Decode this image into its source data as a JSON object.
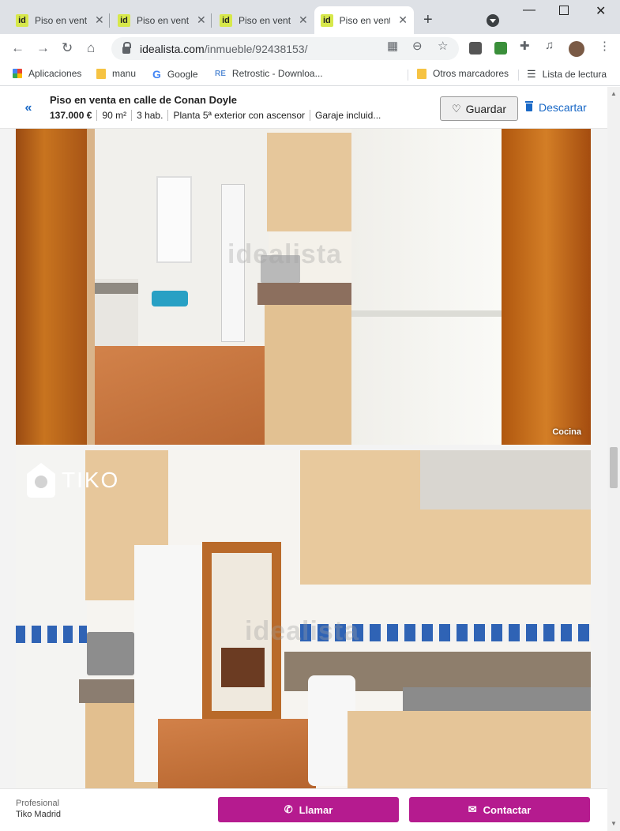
{
  "browser": {
    "tabs": [
      {
        "favicon": "id",
        "title": "Piso en venta"
      },
      {
        "favicon": "id",
        "title": "Piso en venta"
      },
      {
        "favicon": "id",
        "title": "Piso en venta"
      },
      {
        "favicon": "id",
        "title": "Piso en venta"
      }
    ],
    "active_tab_index": 3,
    "url_domain": "idealista.com",
    "url_path": "/inmueble/92438153/",
    "bookmarks": [
      {
        "label": "Aplicaciones",
        "icon": "apps-grid-icon"
      },
      {
        "label": "manu",
        "icon": "folder-icon"
      },
      {
        "label": "Google",
        "icon": "google-icon"
      },
      {
        "label": "Retrostic - Downloa...",
        "icon": "retrostic-icon"
      }
    ],
    "other_bookmarks": "Otros marcadores",
    "reading_list": "Lista de lectura"
  },
  "listing": {
    "title": "Piso en venta en calle de Conan Doyle",
    "price": "137.000 €",
    "area": "90 m²",
    "rooms": "3 hab.",
    "floor": "Planta 5ª exterior con ascensor",
    "garage": "Garaje incluid...",
    "save_label": "Guardar",
    "discard_label": "Descartar"
  },
  "photos": [
    {
      "caption": "Cocina",
      "watermark": "idealista"
    },
    {
      "caption": "",
      "watermark": "idealista",
      "brand_logo": "TIKO"
    }
  ],
  "contact": {
    "agent_type": "Profesional",
    "agent_name": "Tiko Madrid",
    "call_label": "Llamar",
    "contact_label": "Contactar",
    "accent_color": "#b51b8f"
  }
}
